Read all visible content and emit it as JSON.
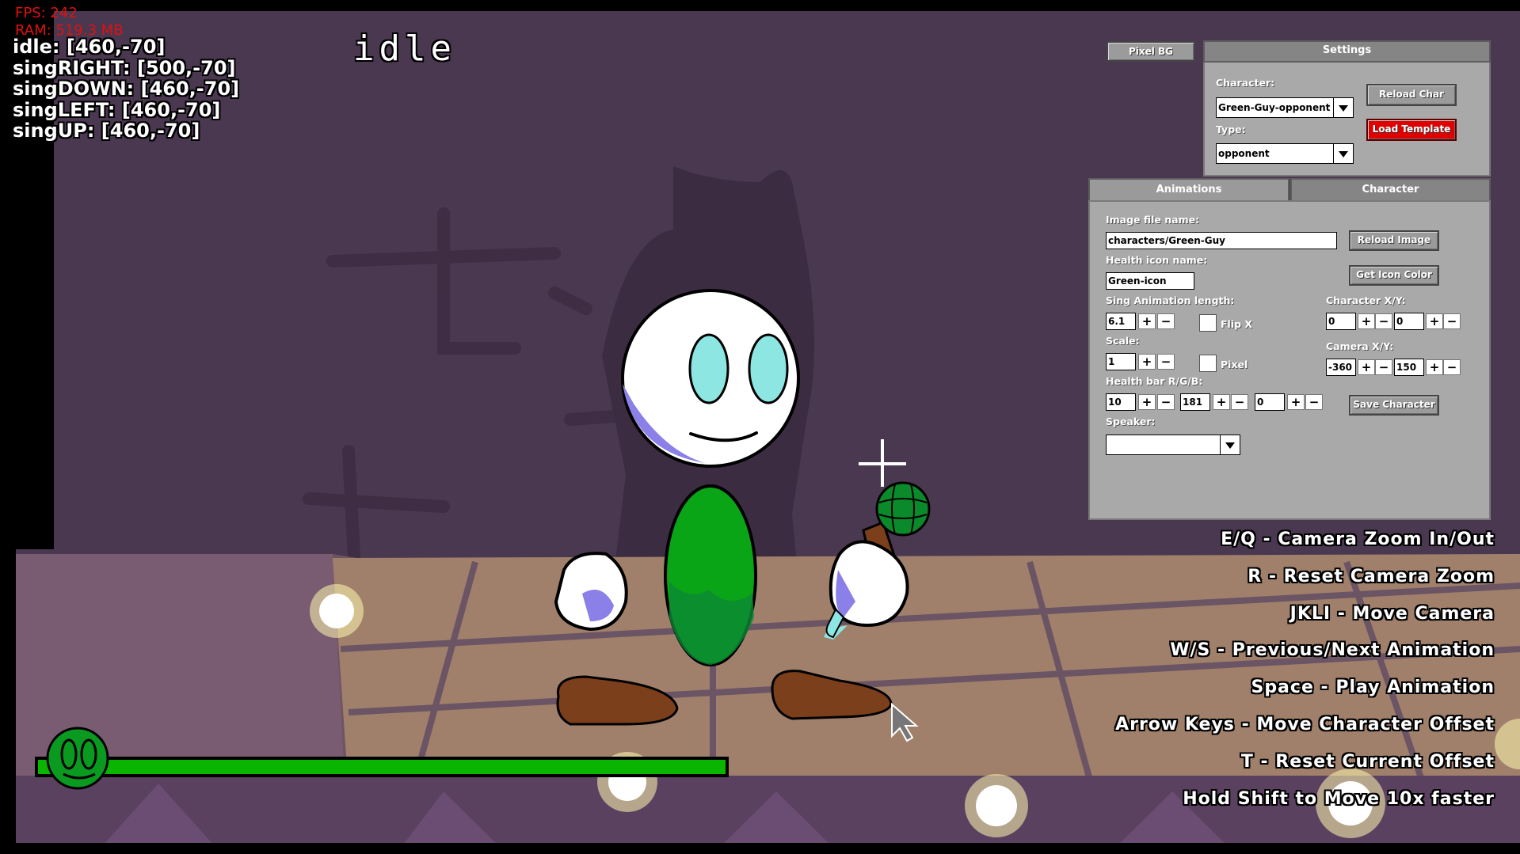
{
  "debug": {
    "fps": "FPS: 242",
    "ram": "RAM: 519.3 MB"
  },
  "offsets": [
    "idle: [460,-70]",
    "singRIGHT: [500,-70]",
    "singDOWN: [460,-70]",
    "singLEFT: [460,-70]",
    "singUP: [460,-70]"
  ],
  "current_animation": "idle",
  "top_buttons": {
    "pixel_bg": "Pixel BG"
  },
  "settings": {
    "title": "Settings",
    "character_label": "Character:",
    "character_value": "Green-Guy-opponent",
    "type_label": "Type:",
    "type_value": "opponent",
    "reload_char": "Reload Char",
    "load_template": "Load Template"
  },
  "tabs": [
    {
      "label": "Animations"
    },
    {
      "label": "Character"
    }
  ],
  "character_tab": {
    "image_file_label": "Image file name:",
    "image_file_value": "characters/Green-Guy",
    "reload_image": "Reload Image",
    "health_icon_label": "Health icon name:",
    "health_icon_value": "Green-icon",
    "get_icon_color": "Get Icon Color",
    "sing_length_label": "Sing Animation length:",
    "sing_length_value": "6.1",
    "flip_x_label": "Flip X",
    "char_xy_label": "Character X/Y:",
    "char_x": "0",
    "char_y": "0",
    "scale_label": "Scale:",
    "scale_value": "1",
    "pixel_label": "Pixel",
    "camera_xy_label": "Camera X/Y:",
    "camera_x": "-360",
    "camera_y": "150",
    "health_rgb_label": "Health bar R/G/B:",
    "health_r": "10",
    "health_g": "181",
    "health_b": "0",
    "save_character": "Save Character",
    "speaker_label": "Speaker:",
    "speaker_value": "",
    "plus": "+",
    "minus": "−"
  },
  "controls": [
    "E/Q - Camera Zoom In/Out",
    "R - Reset Camera Zoom",
    "JKLI - Move Camera",
    "W/S - Previous/Next Animation",
    "Space - Play Animation",
    "Arrow Keys - Move Character Offset",
    "T - Reset Current Offset",
    "Hold Shift to Move 10x faster"
  ],
  "colors": {
    "health_bar": "#0ab500",
    "load_template_bg": "#e00000",
    "panel_bg": "#a9a9a9"
  },
  "icons": {
    "health_icon": "green-guy-face-icon",
    "cursor": "arrow-cursor-icon",
    "camera_crosshair": "crosshair-icon"
  }
}
